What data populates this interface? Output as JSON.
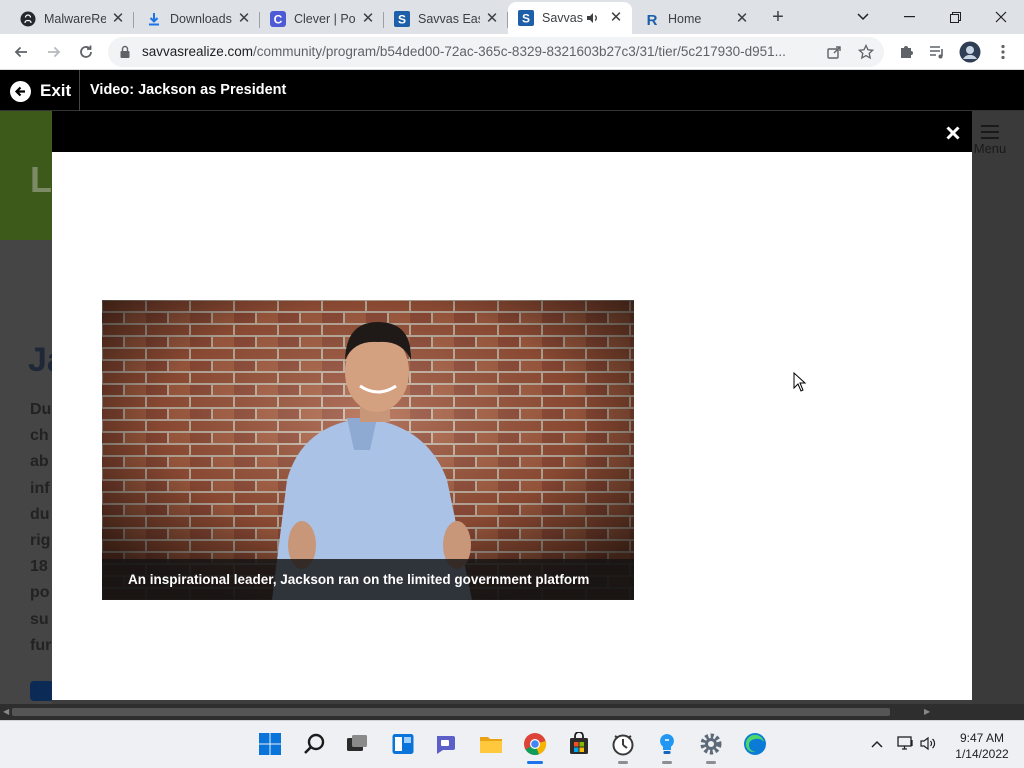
{
  "browser": {
    "tabs": [
      {
        "title": "MalwareRe",
        "icon": "github-icon"
      },
      {
        "title": "Downloads",
        "icon": "download-icon"
      },
      {
        "title": "Clever | Por",
        "icon": "clever-icon"
      },
      {
        "title": "Savvas Eas",
        "icon": "savvas-icon"
      },
      {
        "title": "Savvas",
        "icon": "savvas-icon",
        "active": true
      },
      {
        "title": "Home",
        "icon": "realize-icon"
      }
    ],
    "new_tab": "+",
    "close_glyph": "✕",
    "url_host": "savvasrealize.com",
    "url_path": "/community/program/b54ded00-72ac-365c-8329-8321603b27c3/31/tier/5c217930-d951..."
  },
  "viewer": {
    "exit_label": "Exit",
    "title": "Video: Jackson as President",
    "menu_label": "Menu"
  },
  "background": {
    "banner_letter": "L",
    "heading_letters": "Ja",
    "lines": [
      "Du",
      "ch",
      "ab",
      "inf",
      "du",
      "rig",
      "18",
      "po",
      "su",
      "fur"
    ]
  },
  "modal": {
    "close_glyph": "✕"
  },
  "video": {
    "caption": "An inspirational leader, Jackson ran on the limited government platform"
  },
  "taskbar": {
    "time": "9:47 AM",
    "date": "1/14/2022",
    "apps": [
      "start-icon",
      "search-icon",
      "task-view-icon",
      "widgets-icon",
      "teams-chat-icon",
      "file-explorer-icon",
      "chrome-icon",
      "store-icon",
      "clock-app-icon",
      "lightbulb-app-icon",
      "settings-icon",
      "edge-icon"
    ]
  },
  "colors": {
    "savvas_header": "#000000",
    "modal_bg": "#ffffff",
    "accent": "#1a73e8"
  }
}
